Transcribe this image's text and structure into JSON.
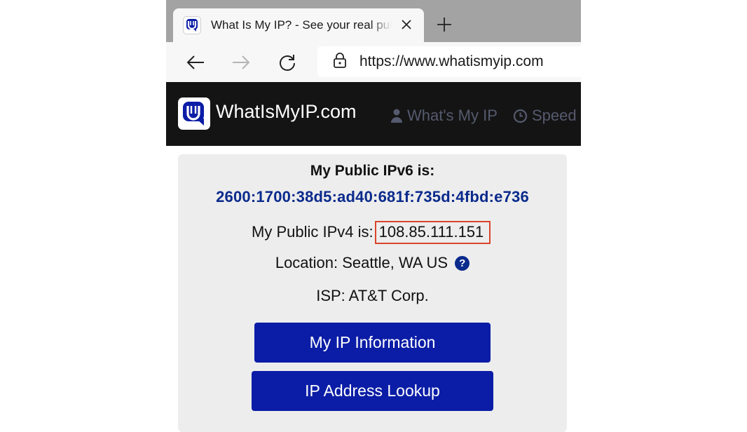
{
  "browser": {
    "tab": {
      "title": "What Is My IP? - See your real public IP address",
      "favicon": "whatismyip-logo-icon"
    },
    "address": {
      "url": "https://www.whatismyip.com",
      "lock_icon": "lock-icon"
    }
  },
  "site": {
    "name": "WhatIsMyIP.com",
    "nav": [
      {
        "label": "What's My IP",
        "icon": "user-icon"
      },
      {
        "label": "Speed",
        "icon": "clock-icon"
      }
    ]
  },
  "main": {
    "ipv6_label": "My Public IPv6 is:",
    "ipv6_value": "2600:1700:38d5:ad40:681f:735d:4fbd:e736",
    "ipv4_label": "My Public IPv4 is:",
    "ipv4_value": "108.85.111.151",
    "location_text": "Location: Seattle, WA US",
    "location_help_glyph": "?",
    "isp_text": "ISP: AT&T Corp.",
    "buttons": {
      "info": "My IP Information",
      "lookup": "IP Address Lookup"
    }
  },
  "colors": {
    "header_bg": "#141414",
    "brand_blue": "#0b1da6",
    "ipv6_blue": "#0a2a8c",
    "highlight_red": "#d9452b",
    "card_bg": "#ededed"
  }
}
